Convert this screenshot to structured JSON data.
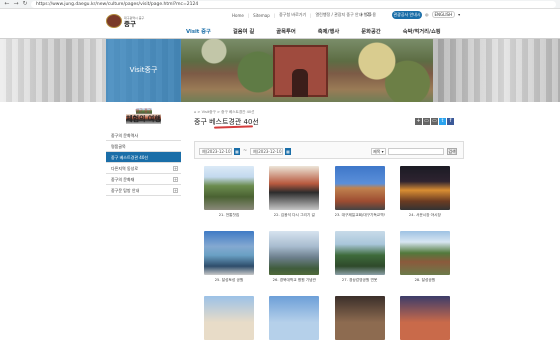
{
  "browser": {
    "url": "https://www.jung.daegu.kr/new/culture/pages/visit/page.html?mc=2124"
  },
  "header": {
    "logo_sub": "대구광역시 중구",
    "logo_title": "중구",
    "util_links": [
      "Home",
      "Sitemap",
      "중구청 바로가기",
      "열린행정 / 관광지 중구 안내 행정 용"
    ],
    "weather": "25",
    "civil_button": "관광공사 안내시설",
    "lang_ko": "",
    "lang_en": "ENGLISH"
  },
  "gnb": [
    "Visit 중구",
    "걸음여 길",
    "골목투어",
    "축제/행사",
    "문화공간",
    "숙박/먹거리/쇼핑"
  ],
  "visual": {
    "title": "Visit중구"
  },
  "sidebar": {
    "logo_top": "대구 중구",
    "logo_bottom": "체험의 여행",
    "items": [
      {
        "label": "중구의 문화역사",
        "plus": false
      },
      {
        "label": "명품골목",
        "plus": false
      },
      {
        "label": "중구 베스트경관 40선",
        "plus": false,
        "active": true
      },
      {
        "label": "다른지역 동성로",
        "plus": true
      },
      {
        "label": "중구의 문화재",
        "plus": true
      },
      {
        "label": "중구문 탐방 안내",
        "plus": true
      }
    ]
  },
  "main": {
    "breadcrumb": "⌂ > Visit중구 > 중구 베스트경관 40선",
    "title": "중구 베스트경관 40선",
    "share": [
      "+",
      "▭",
      "▭",
      "t",
      "f"
    ]
  },
  "filter": {
    "date_from": "예)2023-12-10",
    "date_to": "예)2023-12-10",
    "tilde": "~",
    "select": "제목",
    "search_button": "검색"
  },
  "gallery": [
    {
      "caption": "21. 전통찻집"
    },
    {
      "caption": "22. 김광석 다시 그리기 길"
    },
    {
      "caption": "23. 대구제일교회/대구기독교역사관"
    },
    {
      "caption": "24. 서문시장 야시장"
    },
    {
      "caption": "25. 달성토성 공원"
    },
    {
      "caption": "26. 경북대학교 병원 기념관"
    },
    {
      "caption": "27. 경상감영공원 연못"
    },
    {
      "caption": "28. 달성공원"
    },
    {
      "caption": ""
    },
    {
      "caption": ""
    },
    {
      "caption": ""
    },
    {
      "caption": ""
    }
  ]
}
